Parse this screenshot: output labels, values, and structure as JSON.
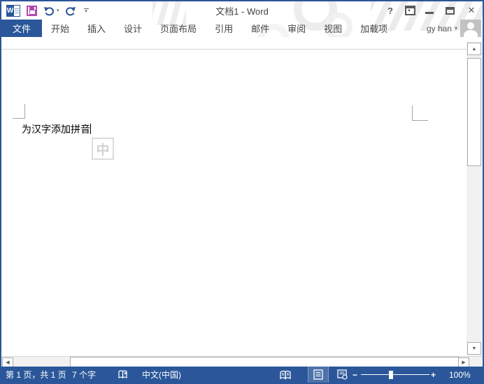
{
  "titlebar": {
    "title": "文档1 - Word",
    "help_label": "?",
    "close_label": "✕"
  },
  "ribbon_tabs": [
    "文件",
    "开始",
    "插入",
    "设计",
    "页面布局",
    "引用",
    "邮件",
    "审阅",
    "视图",
    "加载项"
  ],
  "account": {
    "name": "gy han"
  },
  "document": {
    "body_text": "为汉字添加拼音",
    "ime_indicator": "中"
  },
  "status_bar": {
    "page_info": "第 1 页，共 1 页",
    "word_count": "7 个字",
    "language": "中文(中国)",
    "zoom_out": "−",
    "zoom_in": "+",
    "zoom_level": "100%"
  },
  "icons": {
    "qat": [
      "word-logo",
      "save-icon",
      "undo-icon",
      "redo-icon",
      "customize-qat-icon"
    ],
    "window": [
      "help-icon",
      "ribbon-display-options-icon",
      "minimize-icon",
      "maximize-icon",
      "close-icon"
    ],
    "status": [
      "proofing-icon",
      "read-mode-icon",
      "print-layout-icon",
      "web-layout-icon"
    ]
  },
  "colors": {
    "accent": "#2b579a",
    "save_icon": "#b04ab0",
    "tab_text": "#444444",
    "status_text": "#ffffff",
    "deco": "#ededed",
    "ime_gray": "#d2d2d2"
  }
}
